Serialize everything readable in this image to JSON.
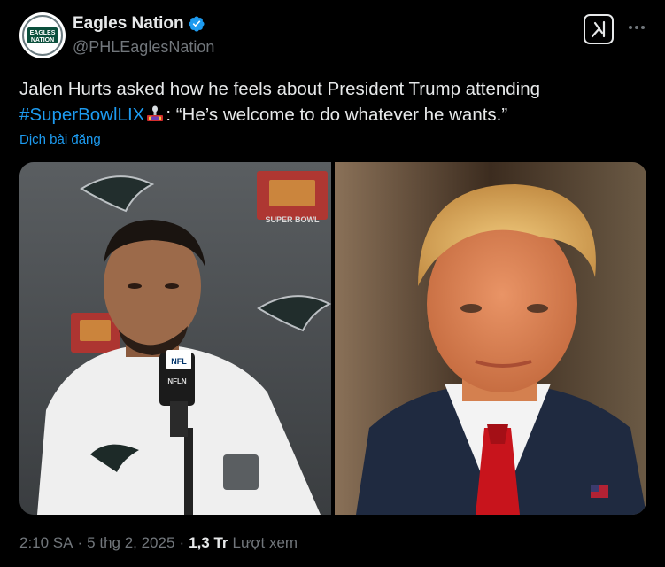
{
  "author": {
    "display_name": "Eagles Nation",
    "handle": "@PHLEaglesNation",
    "avatar_text": "EAGLES NATION"
  },
  "tweet": {
    "text_before": "Jalen Hurts asked how he feels about President Trump attending ",
    "hashtag": "#SuperBowlLIX",
    "text_after": ": “He’s welcome to do whatever he wants.”",
    "translate_label": "Dịch bài đăng"
  },
  "media": {
    "left_image_text": "SUPER BOWL",
    "mic_flag_text": "NFL",
    "mic_flag_subtext": "NFLN"
  },
  "footer": {
    "time": "2:10 SA",
    "separator": "·",
    "date": "5 thg 2, 2025",
    "views_count": "1,3 Tr",
    "views_label": "Lượt xem"
  },
  "colors": {
    "accent": "#1d9bf0",
    "secondary_text": "#71767b"
  }
}
